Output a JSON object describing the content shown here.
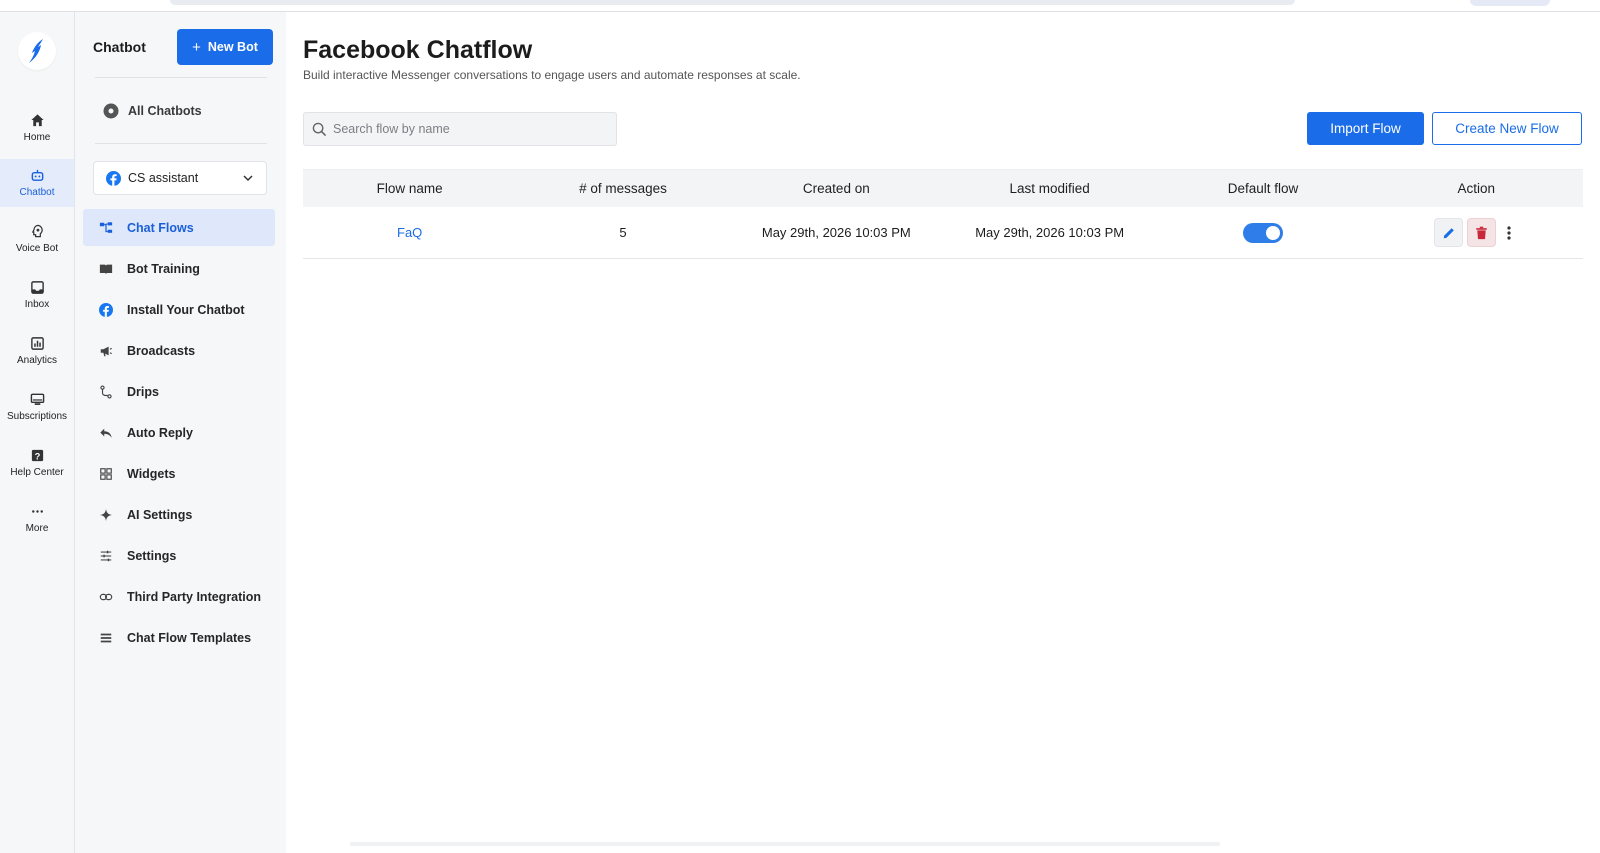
{
  "rail": {
    "items": [
      {
        "label": "Home",
        "icon": "home-icon"
      },
      {
        "label": "Chatbot",
        "icon": "bot-icon",
        "active": true
      },
      {
        "label": "Voice Bot",
        "icon": "voice-icon"
      },
      {
        "label": "Inbox",
        "icon": "inbox-icon"
      },
      {
        "label": "Analytics",
        "icon": "analytics-icon"
      },
      {
        "label": "Subscriptions",
        "icon": "subscriptions-icon"
      },
      {
        "label": "Help Center",
        "icon": "help-icon"
      },
      {
        "label": "More",
        "icon": "more-icon"
      }
    ]
  },
  "sidebar": {
    "title": "Chatbot",
    "new_bot_label": "New Bot",
    "all_chatbots_label": "All Chatbots",
    "selected_bot": "CS assistant",
    "nav": [
      {
        "label": "Chat Flows",
        "icon": "chat-flows-icon",
        "active": true
      },
      {
        "label": "Bot Training",
        "icon": "book-icon"
      },
      {
        "label": "Install Your Chatbot",
        "icon": "facebook-icon"
      },
      {
        "label": "Broadcasts",
        "icon": "megaphone-icon"
      },
      {
        "label": "Drips",
        "icon": "drips-icon"
      },
      {
        "label": "Auto Reply",
        "icon": "reply-icon"
      },
      {
        "label": "Widgets",
        "icon": "widgets-icon"
      },
      {
        "label": "AI Settings",
        "icon": "sparkle-icon"
      },
      {
        "label": "Settings",
        "icon": "sliders-icon"
      },
      {
        "label": "Third Party Integration",
        "icon": "link-icon"
      },
      {
        "label": "Chat Flow Templates",
        "icon": "templates-icon"
      }
    ]
  },
  "main": {
    "title": "Facebook Chatflow",
    "subtitle": "Build interactive Messenger conversations to engage users and automate responses at scale.",
    "search_placeholder": "Search flow by name",
    "import_label": "Import Flow",
    "create_label": "Create New Flow",
    "table": {
      "headers": [
        "Flow name",
        "# of messages",
        "Created on",
        "Last modified",
        "Default flow",
        "Action"
      ],
      "rows": [
        {
          "name": "FaQ",
          "messages": "5",
          "created": "May 29th, 2026 10:03 PM",
          "modified": "May 29th, 2026 10:03 PM",
          "default": true
        }
      ]
    }
  },
  "colors": {
    "accent": "#1a6ce8",
    "active_bg": "#dfe8fb",
    "delete": "#c8283a"
  }
}
